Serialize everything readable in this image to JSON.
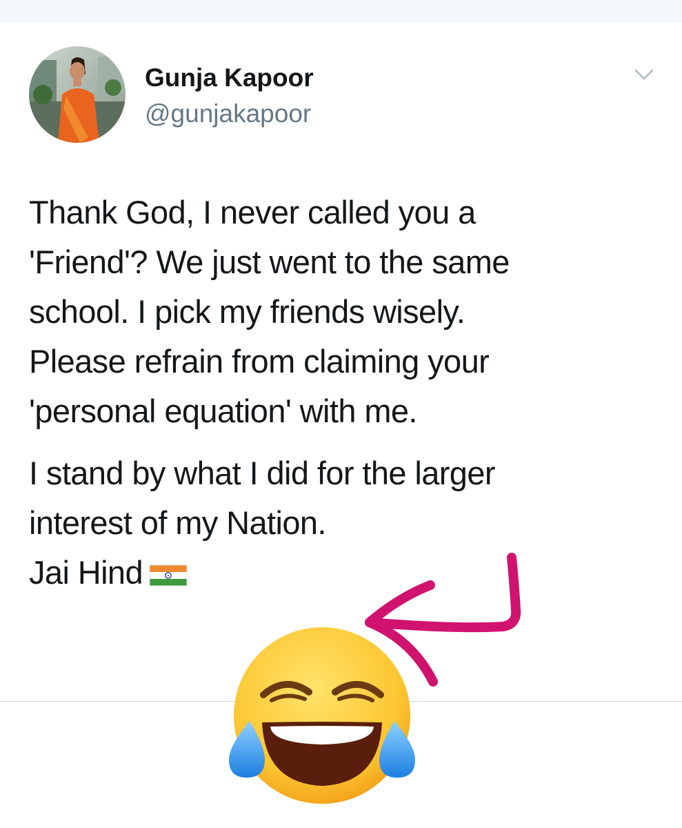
{
  "header": {
    "display_name": "Gunja Kapoor",
    "handle": "@gunjakapoor"
  },
  "icons": {
    "menu": "chevron-down-icon",
    "flag": "india-flag-emoji",
    "reaction": "face-with-tears-of-joy-emoji",
    "annotation": "pink-hand-drawn-arrow"
  },
  "tweet": {
    "paragraph1_lines": [
      "Thank God, I never called you a",
      "'Friend'? We just went to the same",
      "school. I pick my friends wisely.",
      "Please refrain from claiming your",
      "'personal equation' with me."
    ],
    "paragraph2_lines": [
      "I stand by what I did for the larger",
      "interest of my Nation."
    ],
    "closing": "Jai Hind"
  },
  "colors": {
    "text": "#14171a",
    "handle": "#657786",
    "annotation": "#d0136f",
    "divider": "#cfd6dc"
  }
}
